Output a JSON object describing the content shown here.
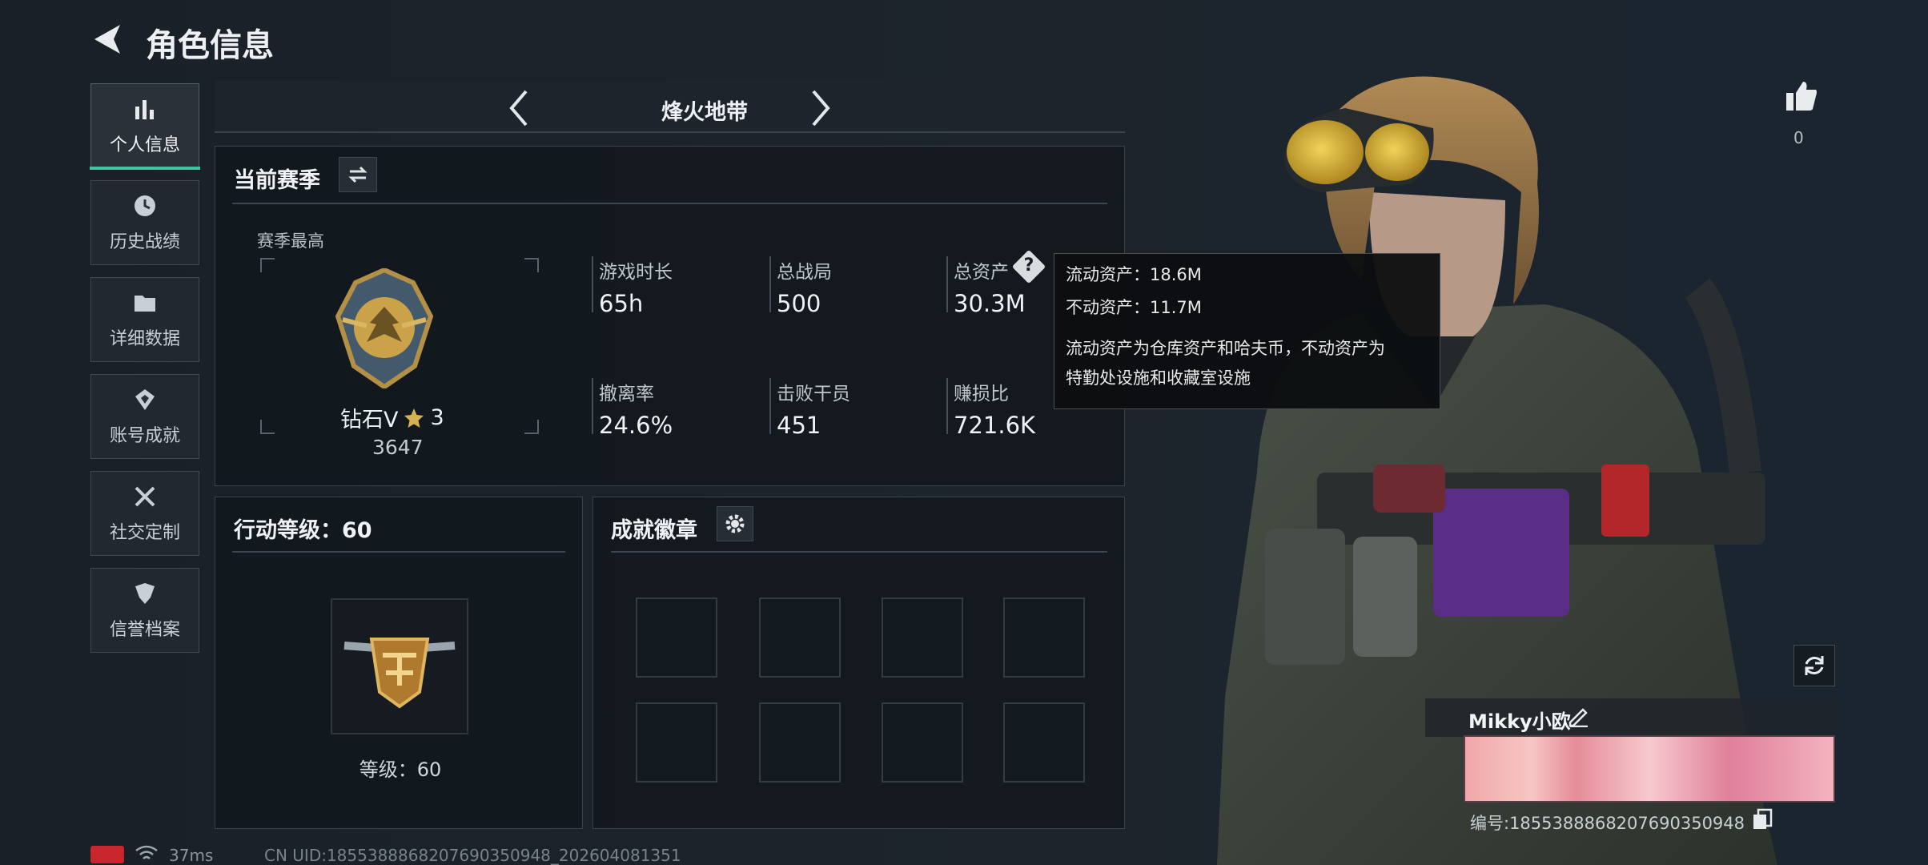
{
  "header": {
    "title": "角色信息"
  },
  "sidebar": {
    "items": [
      {
        "label": "个人信息"
      },
      {
        "label": "历史战绩"
      },
      {
        "label": "详细数据"
      },
      {
        "label": "账号成就"
      },
      {
        "label": "社交定制"
      },
      {
        "label": "信誉档案"
      }
    ]
  },
  "mode": {
    "title": "烽火地带"
  },
  "season": {
    "title": "当前赛季",
    "best_label": "赛季最高",
    "rank": "钻石V",
    "stars": "3",
    "score": "3647",
    "stats": [
      {
        "label": "游戏时长",
        "value": "65h"
      },
      {
        "label": "总战局",
        "value": "500"
      },
      {
        "label": "总资产",
        "value": "30.3M"
      },
      {
        "label": "撤离率",
        "value": "24.6%"
      },
      {
        "label": "击败干员",
        "value": "451"
      },
      {
        "label": "赚损比",
        "value": "721.6K"
      }
    ]
  },
  "tooltip": {
    "liquid": "流动资产：18.6M",
    "fixed": "不动资产：11.7M",
    "line1": "流动资产为仓库资产和哈夫币，不动资产为",
    "line2": "特勤处设施和收藏室设施"
  },
  "action": {
    "title": "行动等级：60",
    "level_label": "等级：60"
  },
  "badges": {
    "title": "成就徽章"
  },
  "likes": {
    "count": "0"
  },
  "player": {
    "name": "Mikky小欧",
    "id": "编号:1855388868207690350948"
  },
  "status": {
    "ping": "37ms",
    "uid": "CN UID:1855388868207690350948_202604081351"
  },
  "colors": {
    "accent": "#3fc4a0",
    "gold": "#c9a24a",
    "panel_bg": "#11171c",
    "tooltip_bg": "#0c0e10"
  }
}
